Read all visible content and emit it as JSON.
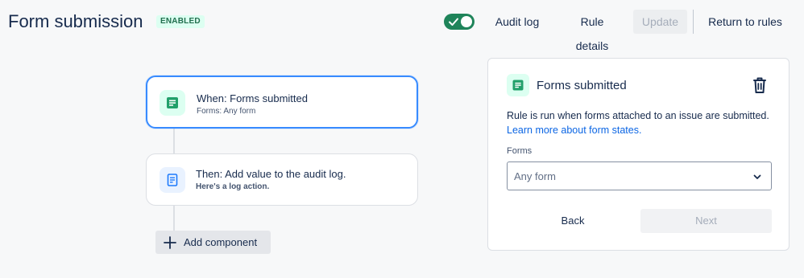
{
  "header": {
    "title": "Form submission",
    "status": "ENABLED",
    "toggle_on": true,
    "audit_log_label": "Audit log",
    "rule_details_label": "Rule details",
    "update_label": "Update",
    "return_label": "Return to rules"
  },
  "flow": {
    "nodes": [
      {
        "title": "When: Forms submitted",
        "subtitle": "Forms: Any form",
        "icon": "form-icon"
      },
      {
        "title": "Then: Add value to the audit log.",
        "subtitle": "Here's a log action.",
        "icon": "log-icon"
      }
    ],
    "add_component_label": "Add component"
  },
  "panel": {
    "title": "Forms submitted",
    "description": "Rule is run when forms attached to an issue are submitted.",
    "link_text": "Learn more about form states.",
    "forms_label": "Forms",
    "select_value": "Any form",
    "back_label": "Back",
    "next_label": "Next"
  },
  "colors": {
    "accent_green": "#1f845a",
    "selection_blue": "#388bff",
    "link_blue": "#0c66e4"
  }
}
